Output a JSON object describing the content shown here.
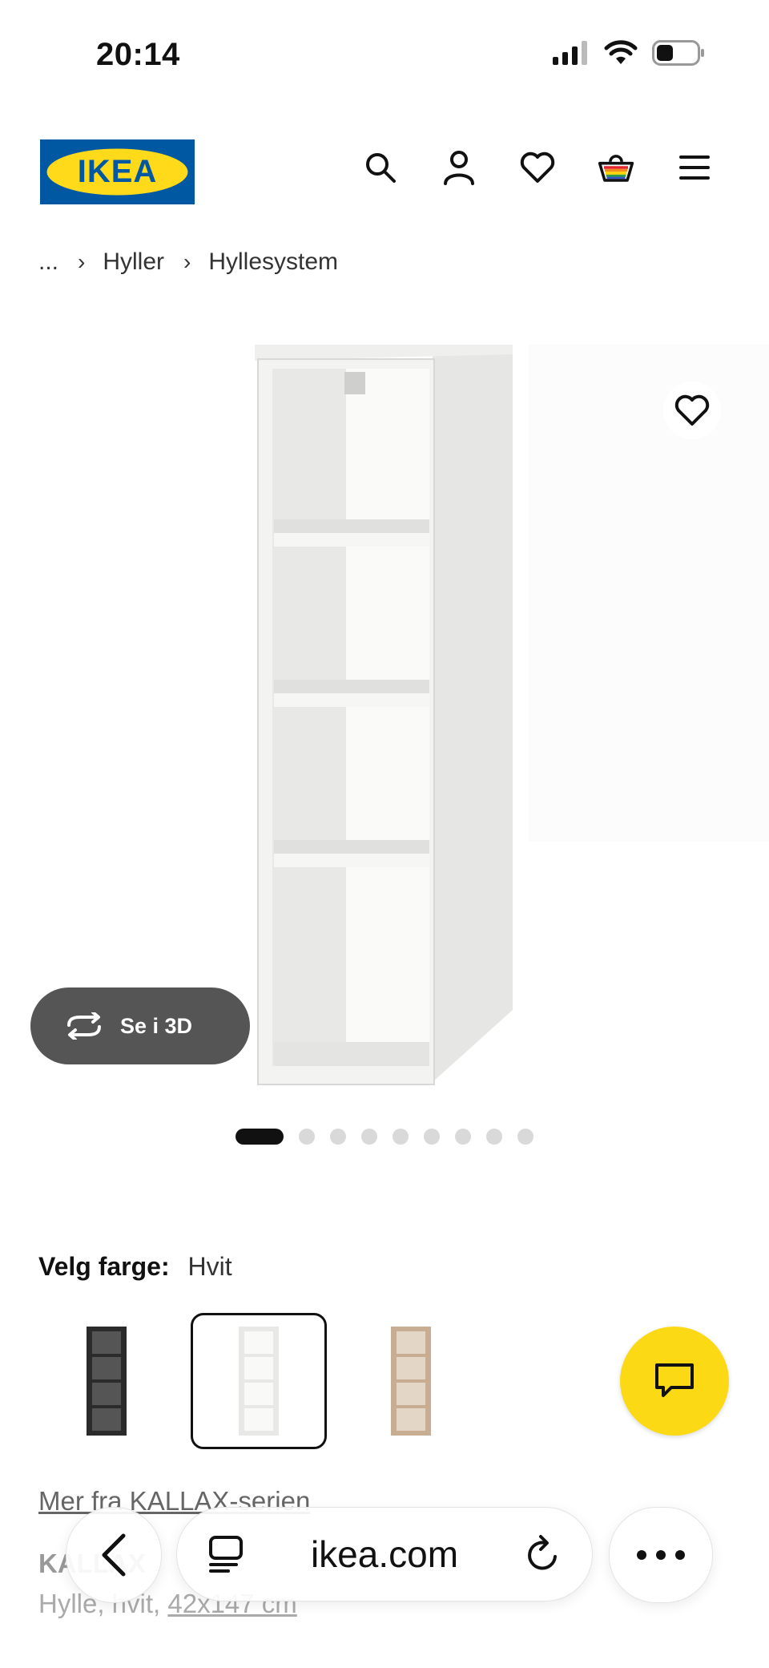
{
  "status_bar": {
    "time": "20:14"
  },
  "header": {
    "logo_text": "IKEA",
    "icons": [
      "search-icon",
      "user-icon",
      "heart-icon",
      "basket-icon",
      "menu-icon"
    ],
    "brand_colors": {
      "blue": "#0058a3",
      "yellow": "#ffda1a"
    }
  },
  "breadcrumb": {
    "items": [
      "...",
      "Hyller",
      "Hyllesystem"
    ]
  },
  "gallery": {
    "see_3d_label": "Se i 3D",
    "active_index": 1,
    "dot_count": 10
  },
  "color_picker": {
    "label": "Velg farge:",
    "selected_value": "Hvit",
    "swatches": [
      "black-brown",
      "white",
      "white-stained-oak"
    ]
  },
  "product": {
    "series_link": "Mer fra KALLAX-serien",
    "name": "KALLAX",
    "description_prefix": "Hylle, hvit, ",
    "dimensions": "42x147 cm"
  },
  "browser": {
    "url": "ikea.com"
  },
  "colors": {
    "chat_fab": "#fbd914",
    "see3d_bg": "#555555"
  }
}
